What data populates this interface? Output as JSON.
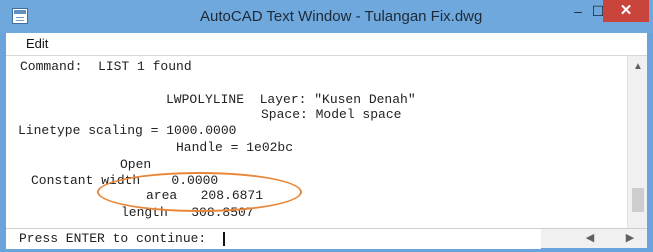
{
  "window": {
    "title": "AutoCAD Text Window - Tulangan Fix.dwg",
    "min_symbol": "–",
    "max_symbol": "☐",
    "close_symbol": "✕",
    "accent": "#6fa8dd",
    "close_color": "#c9443b"
  },
  "menu": {
    "edit": "Edit"
  },
  "output": {
    "lines": [
      "Command:  LIST 1 found",
      "LWPOLYLINE  Layer: \"Kusen Denah\"",
      "Space: Model space",
      "Linetype scaling = 1000.0000",
      "Handle = 1e02bc",
      "Open",
      "Constant width    0.0000",
      "area   208.6871",
      "length   308.8507"
    ],
    "highlight_color": "#e8873a"
  },
  "prompt": {
    "text": "Press ENTER to continue:"
  },
  "icons": {
    "app": "text-window-icon",
    "scroll_up": "▲",
    "scroll_down": "▼",
    "scroll_left": "◀",
    "scroll_right": "▶"
  }
}
